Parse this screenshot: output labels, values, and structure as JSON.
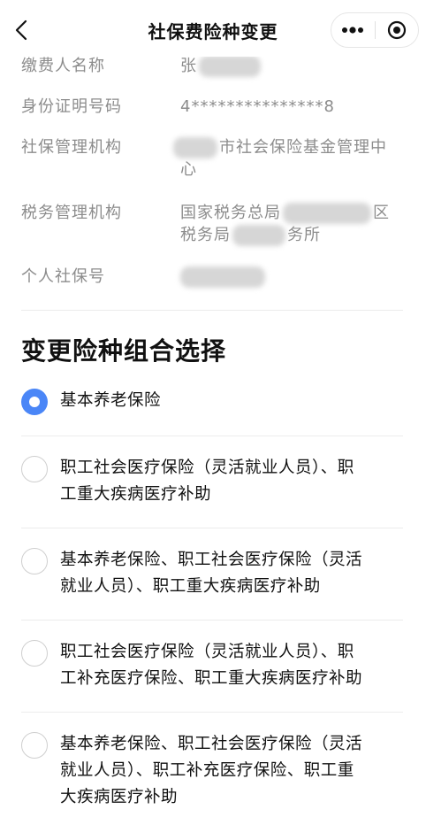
{
  "header": {
    "title": "社保费险种变更",
    "back_icon": "chevron-left-icon",
    "more_icon": "more-dots-icon",
    "target_icon": "record-target-icon"
  },
  "info": {
    "payer_name": {
      "label": "缴费人名称",
      "value": "张"
    },
    "id_number": {
      "label": "身份证明号码",
      "value": "4***************8"
    },
    "social_org": {
      "label": "社保管理机构",
      "value_line1": "市社会保险基金管理中",
      "value_line2": "心"
    },
    "tax_org": {
      "label": "税务管理机构",
      "value_line1_prefix": "国家税务总局",
      "value_line1_suffix": "区",
      "value_line2_prefix": "税务局",
      "value_line2_suffix": "务所"
    },
    "personal_no": {
      "label": "个人社保号",
      "value": ""
    }
  },
  "section": {
    "title": "变更险种组合选择"
  },
  "options": [
    {
      "lines": [
        "基本养老保险"
      ],
      "checked": true
    },
    {
      "lines": [
        "职工社会医疗保险（灵活就业人员）、职",
        "工重大疾病医疗补助"
      ],
      "checked": false
    },
    {
      "lines": [
        "基本养老保险、职工社会医疗保险（灵活",
        "就业人员）、职工重大疾病医疗补助"
      ],
      "checked": false
    },
    {
      "lines": [
        "职工社会医疗保险（灵活就业人员）、职",
        "工补充医疗保险、职工重大疾病医疗补助"
      ],
      "checked": false
    },
    {
      "lines": [
        "基本养老保险、职工社会医疗保险（灵活",
        "就业人员）、职工补充医疗保险、职工重",
        "大疾病医疗补助"
      ],
      "checked": false
    }
  ],
  "colors": {
    "accent": "#4a86f7",
    "label_gray": "#8c8c8c",
    "divider": "#ececec"
  }
}
